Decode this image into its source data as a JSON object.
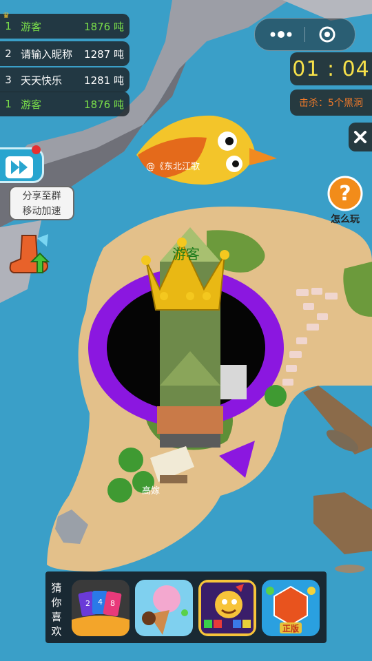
{
  "leaderboard": [
    {
      "rank": "1",
      "name": "游客",
      "score": "1876 吨",
      "me": true,
      "crown": true
    },
    {
      "rank": "2",
      "name": "请输入昵称",
      "score": "1287 吨",
      "me": false
    },
    {
      "rank": "3",
      "name": "天天快乐",
      "score": "1281 吨",
      "me": false
    },
    {
      "rank": "1",
      "name": "游客",
      "score": "1876 吨",
      "me": true
    }
  ],
  "timer": "01 : 04",
  "kills": "击杀：5个黑洞",
  "share": {
    "line1": "分享至群",
    "line2": "移动加速"
  },
  "help_label": "怎么玩",
  "player_name": "游客",
  "enemy_name": "@《东北江歌",
  "other_hole_name": "高嫁",
  "guess_label": [
    "猜",
    "你",
    "喜",
    "欢"
  ],
  "guess_games": [
    {
      "name": "card-game",
      "digits": [
        "2",
        "4",
        "8"
      ]
    },
    {
      "name": "icecream-game"
    },
    {
      "name": "pop-star-game"
    },
    {
      "name": "gem-game",
      "badge": "正版"
    }
  ],
  "colors": {
    "sea": "#3a9fc8",
    "sand": "#e3c08a",
    "grass": "#6c9a3c",
    "hole_ring": "#8b17e0",
    "timer_text": "#f7e14a",
    "kills_text": "#f07a2a",
    "score_green": "#7be04a"
  }
}
